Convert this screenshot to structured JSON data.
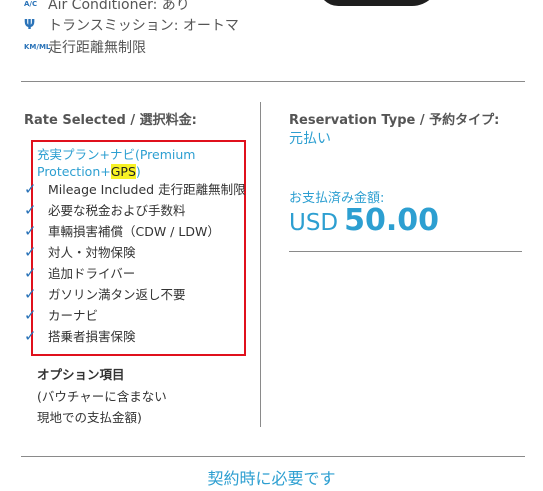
{
  "features": [
    {
      "icon": "air-conditioner-icon",
      "icon_text": "A/C",
      "label": "Air Conditioner: あり"
    },
    {
      "icon": "transmission-icon",
      "icon_text": "Ψ",
      "label": "トランスミッション: オートマ"
    },
    {
      "icon": "mileage-icon",
      "icon_text": "KM/ML",
      "label": "走行距離無制限"
    }
  ],
  "rate": {
    "title": "Rate Selected / 選択料金:",
    "plan_name_prefix": "充実プラン+ナビ(Premium Protection+",
    "plan_name_highlight": "GPS",
    "plan_name_suffix": ")",
    "inclusions": [
      "Mileage Included 走行距離無制限",
      "必要な税金および手数料",
      "車輛損害補償（CDW / LDW）",
      "対人・対物保険",
      "追加ドライバー",
      "ガソリン満タン返し不要",
      "カーナビ",
      "搭乗者損害保険"
    ],
    "options_title": "オプション項目",
    "options_note_1": "(バウチャーに含まない",
    "options_note_2": "現地での支払金額)"
  },
  "reservation": {
    "title": "Reservation Type / 予約タイプ:",
    "value": "元払い",
    "paid_label": "お支払済み金額:",
    "currency": "USD",
    "amount": "50.00"
  },
  "footer": {
    "required_link": "契約時に必要です"
  },
  "colors": {
    "accent": "#2d9fd1",
    "icon": "#2a73b8",
    "highlight_box": "#e0101c",
    "highlight_text": "#f7f225"
  }
}
